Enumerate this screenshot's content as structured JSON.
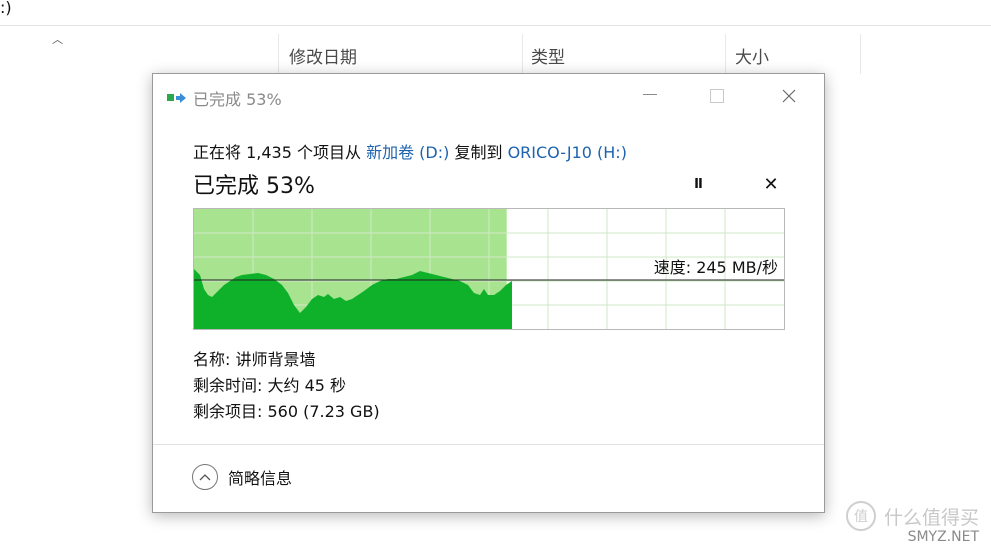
{
  "background": {
    "corner_text": ":)",
    "columns": [
      "修改日期",
      "类型",
      "大小"
    ]
  },
  "dialog": {
    "title": "已完成 53%",
    "copy_prefix": "正在将 1,435 个项目从 ",
    "source": "新加卷 (D:)",
    "copy_middle": " 复制到 ",
    "destination": "ORICO-J10 (H:)",
    "progress_heading": "已完成 53%",
    "progress_percent": 53,
    "pause_glyph": "II",
    "cancel_glyph": "✕",
    "speed": "速度: 245 MB/秒",
    "name_line": "名称: 讲师背景墙",
    "time_line": "剩余时间: 大约 45 秒",
    "items_line": "剩余项目: 560 (7.23 GB)",
    "details_label": "简略信息"
  },
  "colors": {
    "link": "#1d63b0",
    "progress_fill": "#a8e48f",
    "speed_fill": "#0fb02a",
    "grid": "#cfe9c7"
  },
  "icons": [
    "copy-icon",
    "minimize-icon",
    "maximize-icon",
    "close-icon",
    "pause-icon",
    "cancel-icon",
    "chevron-up-icon"
  ],
  "watermark": {
    "logo_glyph": "值",
    "text": "什么值得买",
    "subtext": "SMYZ.NET"
  }
}
